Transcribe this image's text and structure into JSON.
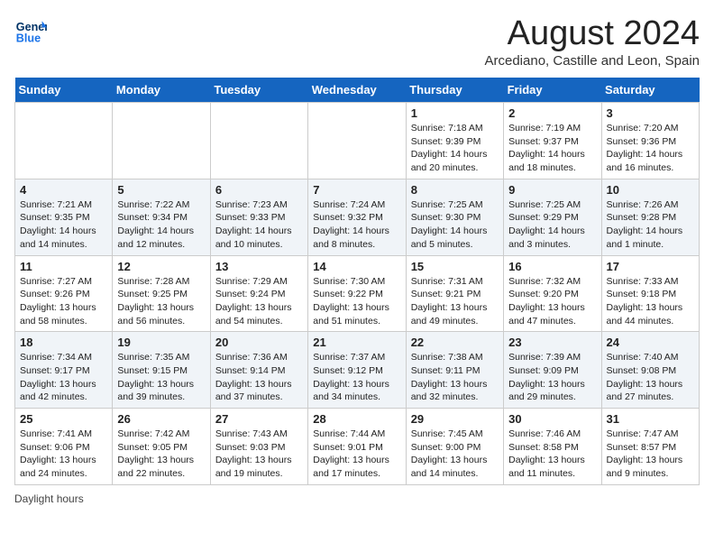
{
  "header": {
    "logo_line1": "General",
    "logo_line2": "Blue",
    "month_year": "August 2024",
    "location": "Arcediano, Castille and Leon, Spain"
  },
  "days_of_week": [
    "Sunday",
    "Monday",
    "Tuesday",
    "Wednesday",
    "Thursday",
    "Friday",
    "Saturday"
  ],
  "footer": {
    "note": "Daylight hours"
  },
  "weeks": [
    [
      {
        "day": "",
        "info": ""
      },
      {
        "day": "",
        "info": ""
      },
      {
        "day": "",
        "info": ""
      },
      {
        "day": "",
        "info": ""
      },
      {
        "day": "1",
        "info": "Sunrise: 7:18 AM\nSunset: 9:39 PM\nDaylight: 14 hours and 20 minutes."
      },
      {
        "day": "2",
        "info": "Sunrise: 7:19 AM\nSunset: 9:37 PM\nDaylight: 14 hours and 18 minutes."
      },
      {
        "day": "3",
        "info": "Sunrise: 7:20 AM\nSunset: 9:36 PM\nDaylight: 14 hours and 16 minutes."
      }
    ],
    [
      {
        "day": "4",
        "info": "Sunrise: 7:21 AM\nSunset: 9:35 PM\nDaylight: 14 hours and 14 minutes."
      },
      {
        "day": "5",
        "info": "Sunrise: 7:22 AM\nSunset: 9:34 PM\nDaylight: 14 hours and 12 minutes."
      },
      {
        "day": "6",
        "info": "Sunrise: 7:23 AM\nSunset: 9:33 PM\nDaylight: 14 hours and 10 minutes."
      },
      {
        "day": "7",
        "info": "Sunrise: 7:24 AM\nSunset: 9:32 PM\nDaylight: 14 hours and 8 minutes."
      },
      {
        "day": "8",
        "info": "Sunrise: 7:25 AM\nSunset: 9:30 PM\nDaylight: 14 hours and 5 minutes."
      },
      {
        "day": "9",
        "info": "Sunrise: 7:25 AM\nSunset: 9:29 PM\nDaylight: 14 hours and 3 minutes."
      },
      {
        "day": "10",
        "info": "Sunrise: 7:26 AM\nSunset: 9:28 PM\nDaylight: 14 hours and 1 minute."
      }
    ],
    [
      {
        "day": "11",
        "info": "Sunrise: 7:27 AM\nSunset: 9:26 PM\nDaylight: 13 hours and 58 minutes."
      },
      {
        "day": "12",
        "info": "Sunrise: 7:28 AM\nSunset: 9:25 PM\nDaylight: 13 hours and 56 minutes."
      },
      {
        "day": "13",
        "info": "Sunrise: 7:29 AM\nSunset: 9:24 PM\nDaylight: 13 hours and 54 minutes."
      },
      {
        "day": "14",
        "info": "Sunrise: 7:30 AM\nSunset: 9:22 PM\nDaylight: 13 hours and 51 minutes."
      },
      {
        "day": "15",
        "info": "Sunrise: 7:31 AM\nSunset: 9:21 PM\nDaylight: 13 hours and 49 minutes."
      },
      {
        "day": "16",
        "info": "Sunrise: 7:32 AM\nSunset: 9:20 PM\nDaylight: 13 hours and 47 minutes."
      },
      {
        "day": "17",
        "info": "Sunrise: 7:33 AM\nSunset: 9:18 PM\nDaylight: 13 hours and 44 minutes."
      }
    ],
    [
      {
        "day": "18",
        "info": "Sunrise: 7:34 AM\nSunset: 9:17 PM\nDaylight: 13 hours and 42 minutes."
      },
      {
        "day": "19",
        "info": "Sunrise: 7:35 AM\nSunset: 9:15 PM\nDaylight: 13 hours and 39 minutes."
      },
      {
        "day": "20",
        "info": "Sunrise: 7:36 AM\nSunset: 9:14 PM\nDaylight: 13 hours and 37 minutes."
      },
      {
        "day": "21",
        "info": "Sunrise: 7:37 AM\nSunset: 9:12 PM\nDaylight: 13 hours and 34 minutes."
      },
      {
        "day": "22",
        "info": "Sunrise: 7:38 AM\nSunset: 9:11 PM\nDaylight: 13 hours and 32 minutes."
      },
      {
        "day": "23",
        "info": "Sunrise: 7:39 AM\nSunset: 9:09 PM\nDaylight: 13 hours and 29 minutes."
      },
      {
        "day": "24",
        "info": "Sunrise: 7:40 AM\nSunset: 9:08 PM\nDaylight: 13 hours and 27 minutes."
      }
    ],
    [
      {
        "day": "25",
        "info": "Sunrise: 7:41 AM\nSunset: 9:06 PM\nDaylight: 13 hours and 24 minutes."
      },
      {
        "day": "26",
        "info": "Sunrise: 7:42 AM\nSunset: 9:05 PM\nDaylight: 13 hours and 22 minutes."
      },
      {
        "day": "27",
        "info": "Sunrise: 7:43 AM\nSunset: 9:03 PM\nDaylight: 13 hours and 19 minutes."
      },
      {
        "day": "28",
        "info": "Sunrise: 7:44 AM\nSunset: 9:01 PM\nDaylight: 13 hours and 17 minutes."
      },
      {
        "day": "29",
        "info": "Sunrise: 7:45 AM\nSunset: 9:00 PM\nDaylight: 13 hours and 14 minutes."
      },
      {
        "day": "30",
        "info": "Sunrise: 7:46 AM\nSunset: 8:58 PM\nDaylight: 13 hours and 11 minutes."
      },
      {
        "day": "31",
        "info": "Sunrise: 7:47 AM\nSunset: 8:57 PM\nDaylight: 13 hours and 9 minutes."
      }
    ]
  ]
}
